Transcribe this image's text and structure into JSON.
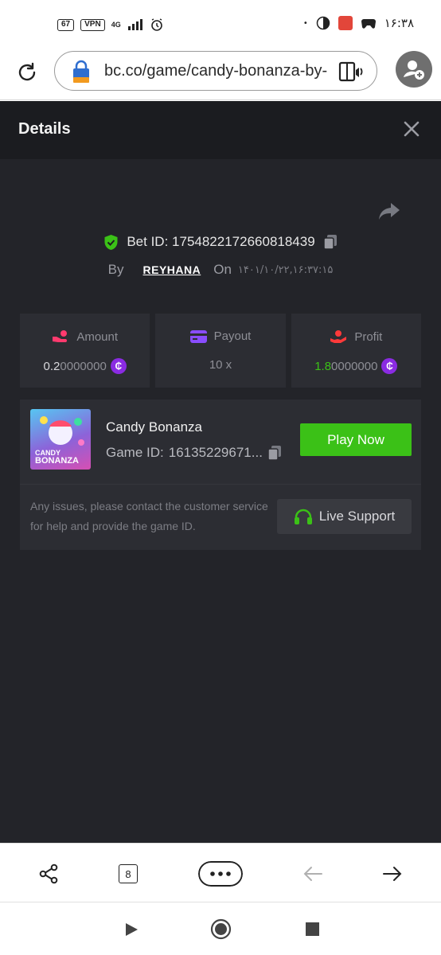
{
  "status_bar": {
    "battery": "67",
    "vpn": "VPN",
    "network": "4G",
    "time": "۱۶:۳۸"
  },
  "browser": {
    "url": "bc.co/game/candy-bonanza-by-",
    "icons": [
      "reload-icon",
      "lock-icon",
      "reader-mode-icon",
      "profile-icon"
    ]
  },
  "details": {
    "title": "Details",
    "bet_label": "Bet ID:",
    "bet_id": "1754822172660818439",
    "by_label": "By",
    "username": "REYHANA",
    "on_label": "On",
    "date": "۱۴۰۱/۱۰/۲۲,۱۶:۳۷:۱۵"
  },
  "stats": {
    "amount": {
      "label": "Amount",
      "value_bright": "0.2",
      "value_dim": "0000000",
      "icon": "hand-coins-icon"
    },
    "payout": {
      "label": "Payout",
      "value": "10 x",
      "icon": "card-icon"
    },
    "profit": {
      "label": "Profit",
      "value_bright": "1.8",
      "value_dim": "0000000",
      "icon": "profit-hand-icon"
    },
    "coin_symbol": "₵"
  },
  "game": {
    "name": "Candy Bonanza",
    "id_label": "Game ID:",
    "id_value": "16135229671...",
    "play_label": "Play Now",
    "thumb_text_top": "CANDY",
    "thumb_text_bottom": "BONANZA",
    "support_text": "Any issues, please contact the customer service for help and provide the game ID.",
    "support_label": "Live Support"
  },
  "toolbar": {
    "tab_count": "8"
  },
  "colors": {
    "accent_green": "#3bc117",
    "coin_purple": "#8a2be2",
    "panel": "#2c2d33",
    "background": "#232429"
  }
}
